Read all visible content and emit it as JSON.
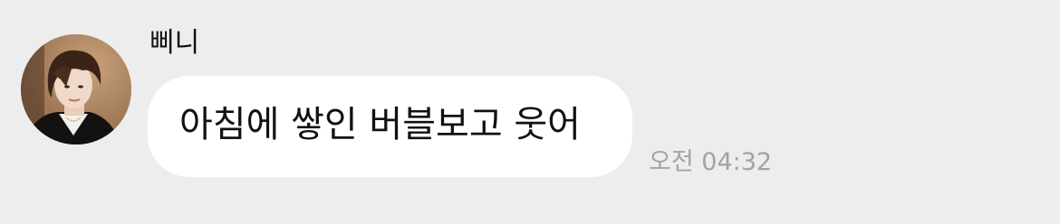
{
  "sender": {
    "name": "삐니",
    "avatar_icon": "profile-photo"
  },
  "message": {
    "text": "아침에 쌓인 버블보고 웃어",
    "time": "오전 04:32"
  },
  "colors": {
    "background": "#ededed",
    "bubble": "#ffffff",
    "text": "#111111",
    "timestamp": "#a3a3a3"
  }
}
